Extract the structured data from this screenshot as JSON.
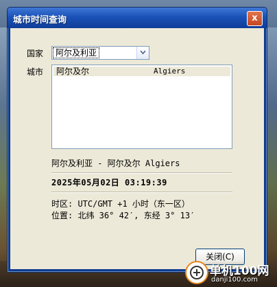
{
  "window": {
    "title": "城市时间查询",
    "close_glyph": "x"
  },
  "country": {
    "label": "国家",
    "selected": "阿尔及利亚"
  },
  "city": {
    "label": "城市",
    "rows": [
      {
        "name": "阿尔及尔",
        "english": "Algiers"
      }
    ]
  },
  "info": {
    "location_line": "阿尔及利亚 - 阿尔及尔 Algiers",
    "datetime": "2025年05月02日  03:19:39",
    "timezone": "时区: UTC/GMT +1 小时（东一区）",
    "position": "位置: 北纬 36° 42′, 东经 3° 13′"
  },
  "buttons": {
    "close_label": "关闭(C)"
  },
  "watermark": {
    "title": "单机100网",
    "url": "danji100.com"
  },
  "colors": {
    "titlebar": "#1b52b8",
    "client_bg": "#ece9d8",
    "selected_row_bg": "#ece9d8"
  },
  "icons": {
    "dropdown": "chevron-down-icon",
    "watermark": "plus-logo-icon"
  }
}
